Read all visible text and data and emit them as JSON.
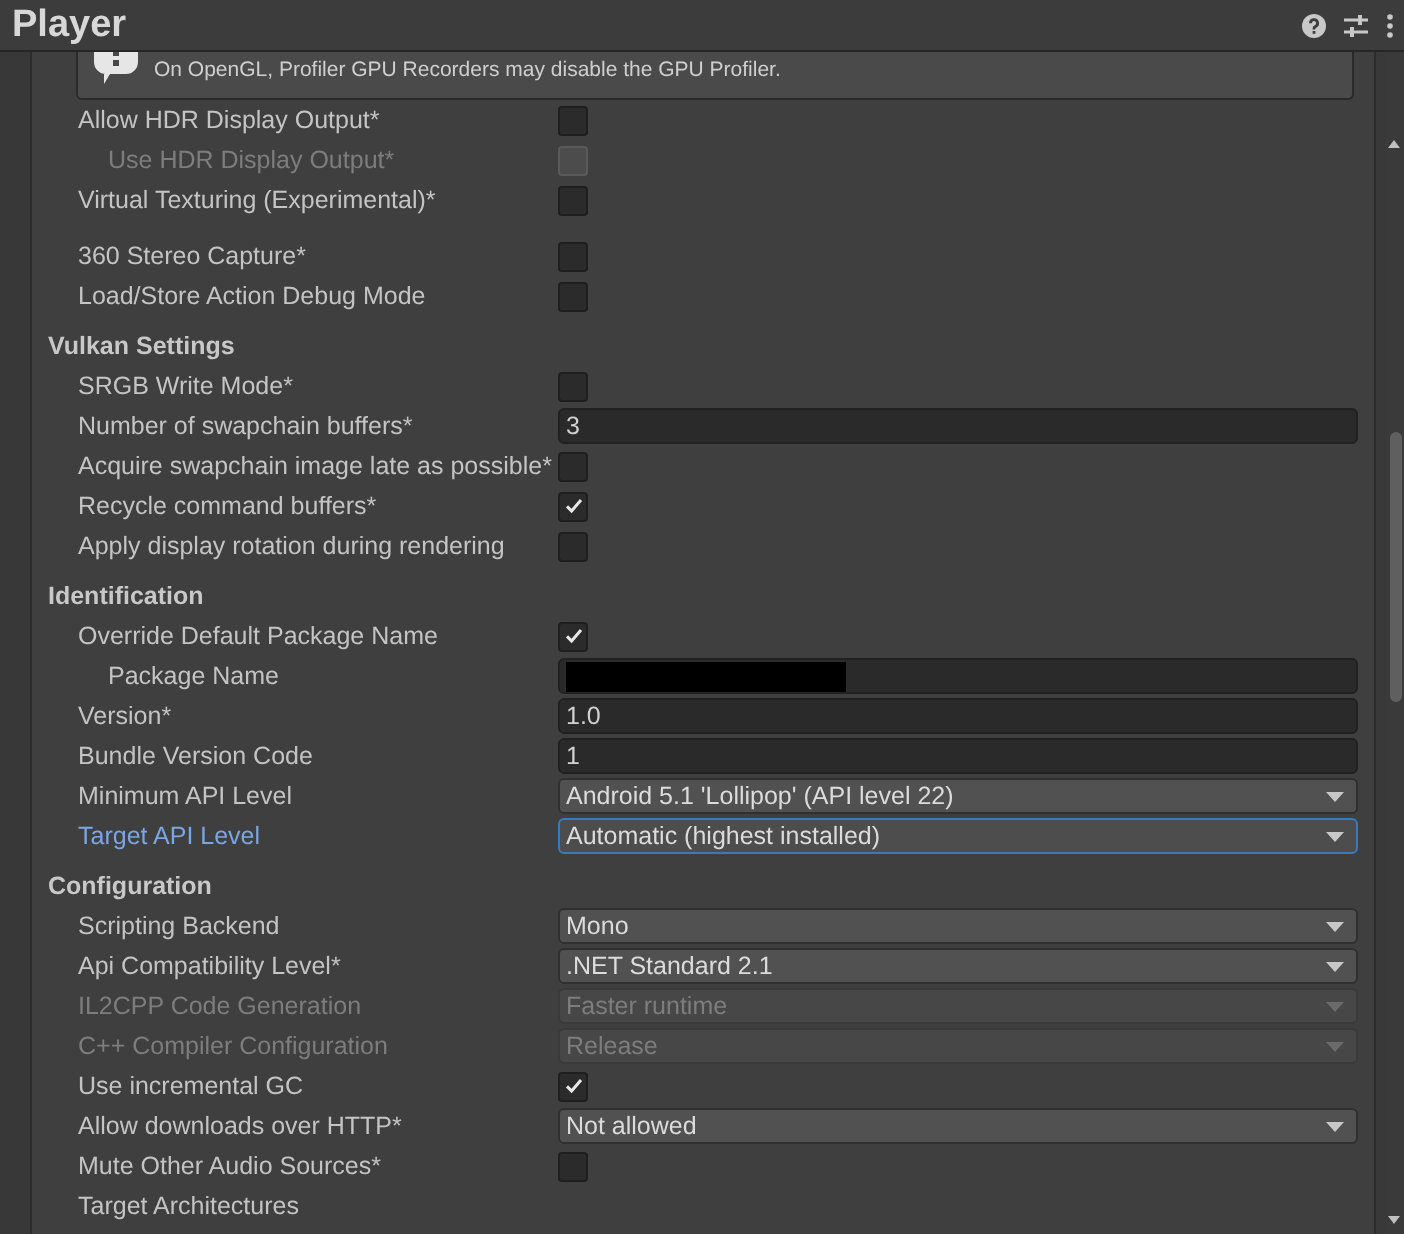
{
  "window": {
    "title": "Player"
  },
  "warning": {
    "text": "On OpenGL, Profiler GPU Recorders may disable the GPU Profiler."
  },
  "sections": [
    {
      "items": [
        {
          "kind": "checkbox",
          "label": "Allow HDR Display Output*",
          "checked": false,
          "disabled": false,
          "children": [
            {
              "kind": "checkbox",
              "label": "Use HDR Display Output*",
              "checked": false,
              "disabled": true
            }
          ]
        },
        {
          "kind": "checkbox",
          "label": "Virtual Texturing (Experimental)*",
          "checked": false,
          "disabled": false
        },
        {
          "kind": "checkbox",
          "label": "360 Stereo Capture*",
          "checked": false,
          "disabled": false,
          "gap_before": true
        },
        {
          "kind": "checkbox",
          "label": "Load/Store Action Debug Mode",
          "checked": false,
          "disabled": false
        }
      ]
    },
    {
      "title": "Vulkan Settings",
      "items": [
        {
          "kind": "checkbox",
          "label": "SRGB Write Mode*",
          "checked": false,
          "disabled": false
        },
        {
          "kind": "field",
          "label": "Number of swapchain buffers*",
          "value": "3"
        },
        {
          "kind": "checkbox",
          "label": "Acquire swapchain image late as possible*",
          "checked": false,
          "disabled": false
        },
        {
          "kind": "checkbox",
          "label": "Recycle command buffers*",
          "checked": true,
          "disabled": false
        },
        {
          "kind": "checkbox",
          "label": "Apply display rotation during rendering",
          "checked": false,
          "disabled": false
        }
      ]
    },
    {
      "title": "Identification",
      "items": [
        {
          "kind": "checkbox",
          "label": "Override Default Package Name",
          "checked": true,
          "disabled": false,
          "children": [
            {
              "kind": "field",
              "label": "Package Name",
              "redacted": true
            }
          ]
        },
        {
          "kind": "field",
          "label": "Version*",
          "value": "1.0"
        },
        {
          "kind": "field",
          "label": "Bundle Version Code",
          "value": "1"
        },
        {
          "kind": "dropdown",
          "label": "Minimum API Level",
          "value": "Android 5.1 'Lollipop' (API level 22)",
          "disabled": false,
          "focused": false
        },
        {
          "kind": "dropdown",
          "label": "Target API Level",
          "value": "Automatic (highest installed)",
          "disabled": false,
          "focused": true
        }
      ]
    },
    {
      "title": "Configuration",
      "items": [
        {
          "kind": "dropdown",
          "label": "Scripting Backend",
          "value": "Mono",
          "disabled": false,
          "focused": false
        },
        {
          "kind": "dropdown",
          "label": "Api Compatibility Level*",
          "value": ".NET Standard 2.1",
          "disabled": false,
          "focused": false
        },
        {
          "kind": "dropdown",
          "label": "IL2CPP Code Generation",
          "value": "Faster runtime",
          "disabled": true,
          "focused": false
        },
        {
          "kind": "dropdown",
          "label": "C++ Compiler Configuration",
          "value": "Release",
          "disabled": true,
          "focused": false
        },
        {
          "kind": "checkbox",
          "label": "Use incremental GC",
          "checked": true,
          "disabled": false
        },
        {
          "kind": "dropdown",
          "label": "Allow downloads over HTTP*",
          "value": "Not allowed",
          "disabled": false,
          "focused": false
        },
        {
          "kind": "checkbox",
          "label": "Mute Other Audio Sources*",
          "checked": false,
          "disabled": false
        },
        {
          "kind": "label",
          "label": "Target Architectures",
          "disabled": false
        }
      ]
    }
  ]
}
